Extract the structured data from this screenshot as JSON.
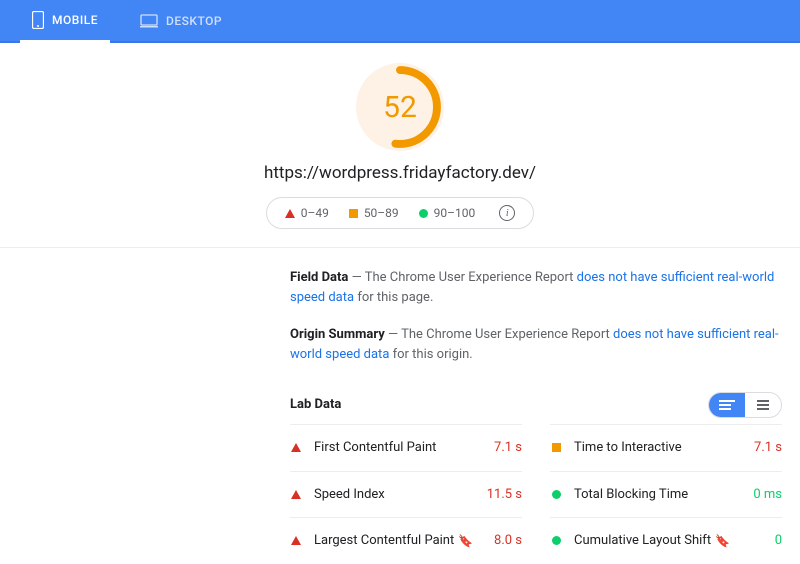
{
  "tabs": {
    "mobile": "MOBILE",
    "desktop": "DESKTOP"
  },
  "score": 52,
  "url": "https://wordpress.fridayfactory.dev/",
  "legend": {
    "poor": "0–49",
    "avg": "50–89",
    "good": "90–100"
  },
  "field_data": {
    "label": "Field Data",
    "pre": "  —  The Chrome User Experience Report ",
    "link": "does not have sufficient real-world speed data",
    "post": " for this page."
  },
  "origin_summary": {
    "label": "Origin Summary",
    "pre": "  —  The Chrome User Experience Report ",
    "link": "does not have sufficient real-world speed data",
    "post": " for this origin."
  },
  "lab_data_label": "Lab Data",
  "metrics": {
    "fcp": {
      "name": "First Contentful Paint",
      "value": "7.1 s"
    },
    "si": {
      "name": "Speed Index",
      "value": "11.5 s"
    },
    "lcp": {
      "name": "Largest Contentful Paint",
      "value": "8.0 s"
    },
    "tti": {
      "name": "Time to Interactive",
      "value": "7.1 s"
    },
    "tbt": {
      "name": "Total Blocking Time",
      "value": "0 ms"
    },
    "cls": {
      "name": "Cumulative Layout Shift",
      "value": "0"
    }
  }
}
